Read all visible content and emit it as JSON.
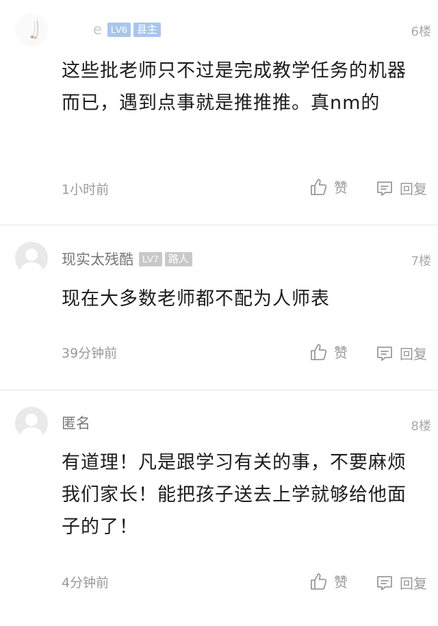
{
  "comments": [
    {
      "username": "e",
      "level": "LV6",
      "title": "县主",
      "floor": "6楼",
      "text": "这些批老师只不过是完成教学任务的机器而已，遇到点事就是推推推。真nm的",
      "time": "1小时前",
      "like_label": "赞",
      "reply_label": "回复"
    },
    {
      "username": "现实太残酷",
      "level": "LV7",
      "title": "路人",
      "floor": "7楼",
      "text": "现在大多数老师都不配为人师表",
      "time": "39分钟前",
      "like_label": "赞",
      "reply_label": "回复"
    },
    {
      "username": "匿名",
      "floor": "8楼",
      "text": "有道理！凡是跟学习有关的事，不要麻烦我们家长！能把孩子送去上学就够给他面子的了！",
      "time": "4分钟前",
      "like_label": "赞",
      "reply_label": "回复"
    }
  ]
}
